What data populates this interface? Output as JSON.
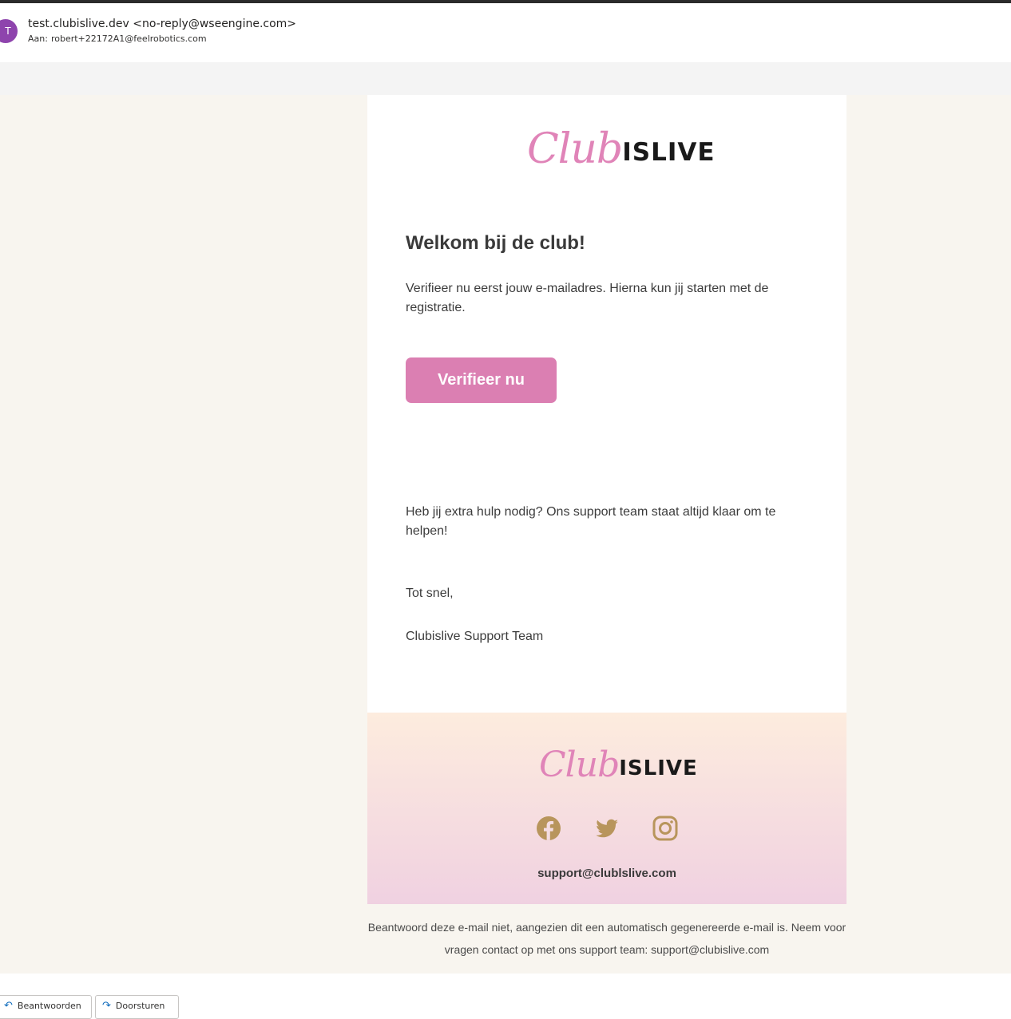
{
  "email_header": {
    "avatar_letter": "T",
    "from": "test.clubislive.dev <no-reply@wseengine.com>",
    "to_label": "Aan:",
    "to_address": "robert+22172A1@feelrobotics.com"
  },
  "brand": {
    "logo_script": "Club",
    "logo_bold": "ISLIVE",
    "pink": "#db7fb2",
    "icon_gold": "#b8955c"
  },
  "body": {
    "title": "Welkom bij de club!",
    "intro": "Verifieer nu eerst jouw e-mailadres. Hierna kun jij starten met de registratie.",
    "button_label": "Verifieer nu",
    "help": "Heb jij extra hulp nodig? Ons support team staat altijd klaar om te helpen!",
    "closing": "Tot snel,",
    "signature": "Clubislive Support Team"
  },
  "footer": {
    "social_icons": [
      "facebook-icon",
      "twitter-icon",
      "instagram-icon"
    ],
    "support_email": "support@clublslive.com"
  },
  "disclaimer": "Beantwoord deze e-mail niet, aangezien dit een automatisch gegenereerde e-mail is. Neem voor vragen contact op met ons support team: support@clubislive.com",
  "actions": {
    "reply_label": "Beantwoorden",
    "forward_label": "Doorsturen"
  }
}
